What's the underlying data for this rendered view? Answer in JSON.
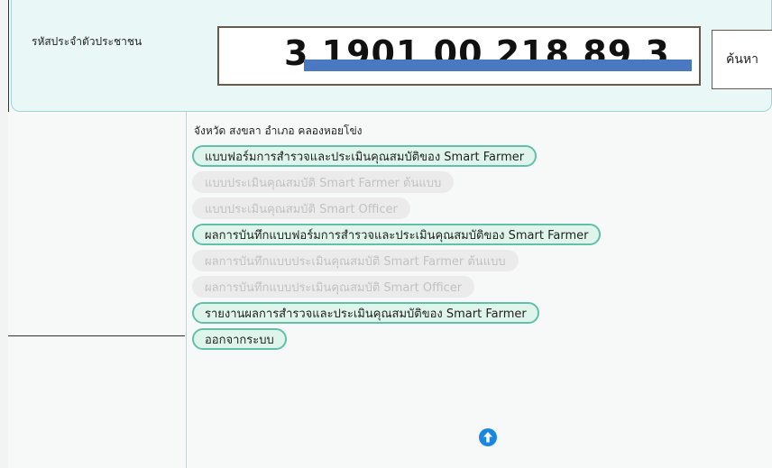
{
  "search": {
    "label": "รหัสประจำตัวประชาชน",
    "value": "3 1901 00 218 89 3",
    "button_label": "ค้นหา"
  },
  "location_text": "จังหวัด สงขลา อำเภอ คลองหอยโข่ง",
  "menu": {
    "items": [
      {
        "label": "แบบฟอร์มการสำรวจและประเมินคุณสมบัติของ Smart Farmer",
        "state": "active"
      },
      {
        "label": "แบบประเมินคุณสมบัติ Smart Farmer ต้นแบบ",
        "state": "disabled"
      },
      {
        "label": "แบบประเมินคุณสมบัติ Smart Officer",
        "state": "disabled"
      },
      {
        "label": "ผลการบันทึกแบบฟอร์มการสำรวจและประเมินคุณสมบัติของ Smart Farmer",
        "state": "active"
      },
      {
        "label": "ผลการบันทึกแบบประเมินคุณสมบัติ Smart Farmer ต้นแบบ",
        "state": "disabled"
      },
      {
        "label": "ผลการบันทึกแบบประเมินคุณสมบัติ Smart Officer",
        "state": "disabled"
      },
      {
        "label": "รายงานผลการสำรวจและประเมินคุณสมบัติของ Smart Farmer",
        "state": "active"
      },
      {
        "label": "ออกจากระบบ",
        "state": "active"
      }
    ]
  },
  "icons": {
    "scroll_top": "arrow-up-circle-icon"
  },
  "colors": {
    "panel_bg": "#e9f7f7",
    "menu_active_border": "#62c0a8",
    "menu_active_bg": "#dff5ec",
    "menu_disabled_bg": "#ebebeb",
    "menu_disabled_text": "#c2c2c2",
    "redaction": "#4a79c1",
    "scroll_icon": "#1a88e0"
  }
}
